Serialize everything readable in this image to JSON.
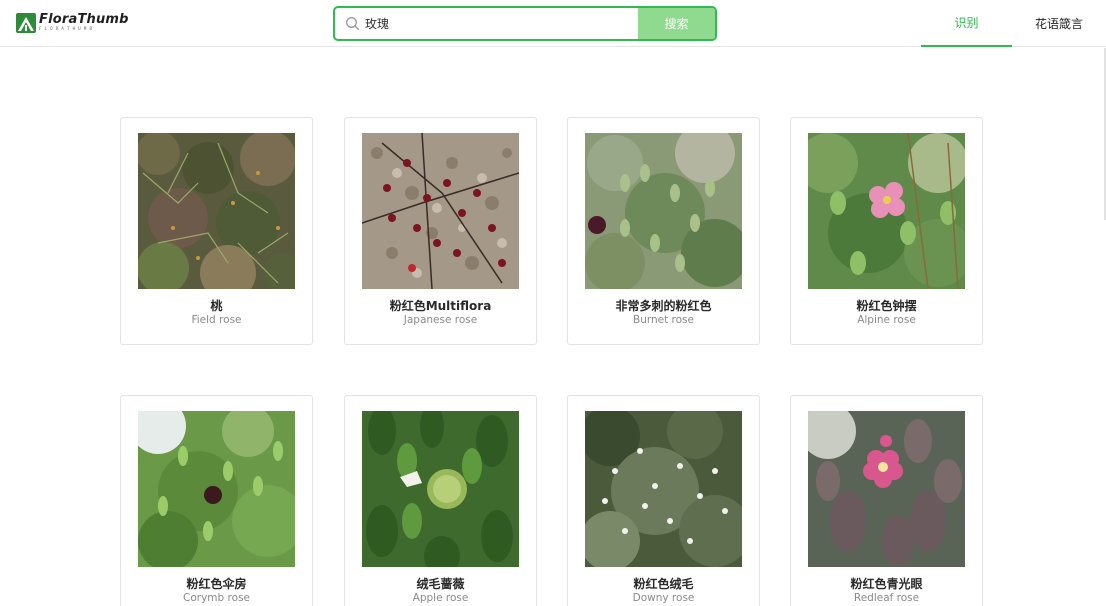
{
  "header": {
    "logo_name": "FloraThumb",
    "logo_sub": "FLORATHUMB",
    "search": {
      "value": "玫瑰",
      "button_label": "搜索"
    },
    "tabs": [
      {
        "label": "识别",
        "active": true
      },
      {
        "label": "花语箴言",
        "active": false
      }
    ]
  },
  "colors": {
    "accent": "#2fbb4f",
    "search_button": "#8fda8f"
  },
  "results": [
    {
      "title": "桃",
      "subtitle": "Field rose",
      "photo": "field-rose-photo"
    },
    {
      "title": "粉红色Multiflora",
      "subtitle": "Japanese rose",
      "photo": "japanese-rose-photo"
    },
    {
      "title": "非常多刺的粉红色",
      "subtitle": "Burnet rose",
      "photo": "burnet-rose-photo"
    },
    {
      "title": "粉红色钟摆",
      "subtitle": "Alpine rose",
      "photo": "alpine-rose-photo"
    },
    {
      "title": "粉红色伞房",
      "subtitle": "Corymb rose",
      "photo": "corymb-rose-photo"
    },
    {
      "title": "绒毛蔷薇",
      "subtitle": "Apple rose",
      "photo": "apple-rose-photo"
    },
    {
      "title": "粉红色绒毛",
      "subtitle": "Downy rose",
      "photo": "downy-rose-photo"
    },
    {
      "title": "粉红色青光眼",
      "subtitle": "Redleaf rose",
      "photo": "redleaf-rose-photo"
    }
  ]
}
